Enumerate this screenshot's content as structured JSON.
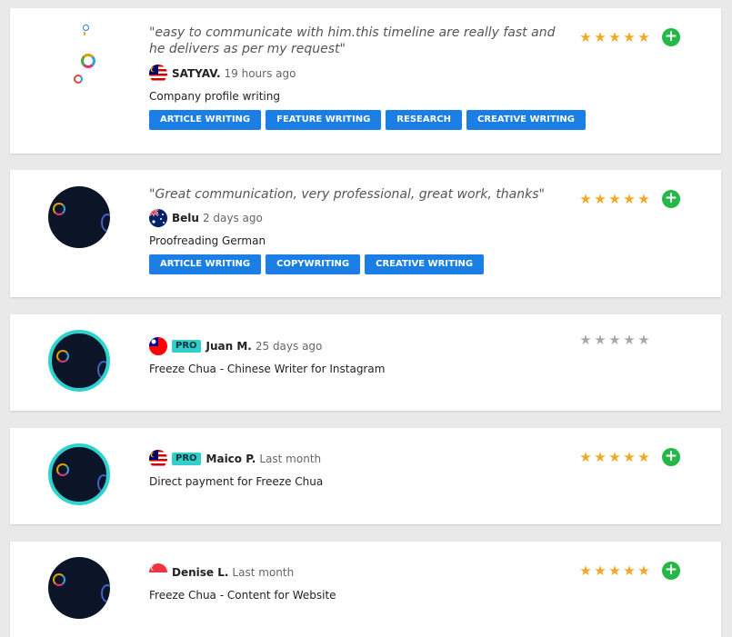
{
  "reviews": [
    {
      "quote": "\"easy to communicate with him.this timeline are really fast and he delivers as per my request\"",
      "flag": "malaysia-flag-icon",
      "pro_badge": "",
      "name": "SATYAV.",
      "time": "19 hours ago",
      "job": "Company profile writing",
      "tags": [
        "ARTICLE WRITING",
        "FEATURE WRITING",
        "RESEARCH",
        "CREATIVE WRITING"
      ],
      "rating": 5,
      "avatar": "logo-icon"
    },
    {
      "quote": "\"Great communication, very professional, great work, thanks\"",
      "flag": "australia-flag-icon",
      "pro_badge": "",
      "name": "Belu",
      "time": "2 days ago",
      "job": "Proofreading German",
      "tags": [
        "ARTICLE WRITING",
        "COPYWRITING",
        "CREATIVE WRITING"
      ],
      "rating": 5,
      "avatar": "avatar-dark"
    },
    {
      "quote": "",
      "flag": "taiwan-flag-icon",
      "pro_badge": "PRO",
      "name": "Juan M.",
      "time": "25 days ago",
      "job": "Freeze Chua - Chinese Writer for Instagram",
      "tags": [],
      "rating": 0,
      "avatar": "avatar-dark-pro"
    },
    {
      "quote": "",
      "flag": "malaysia-flag-icon",
      "pro_badge": "PRO",
      "name": "Maico P.",
      "time": "Last month",
      "job": "Direct payment for Freeze Chua",
      "tags": [],
      "rating": 5,
      "avatar": "avatar-dark-pro"
    },
    {
      "quote": "",
      "flag": "singapore-flag-icon",
      "pro_badge": "",
      "name": "Denise L.",
      "time": "Last month",
      "job": "Freeze Chua - Content for Website",
      "tags": [],
      "rating": 5,
      "avatar": "avatar-dark"
    }
  ],
  "colors": {
    "tag_blue": "#1a7ee5",
    "star_gold": "#f5a623",
    "star_gray": "#a9a9a9",
    "plus_green": "#24b947",
    "pro_teal": "#30cfcb"
  },
  "icons": {
    "star": "star-icon",
    "plus": "plus-icon"
  }
}
